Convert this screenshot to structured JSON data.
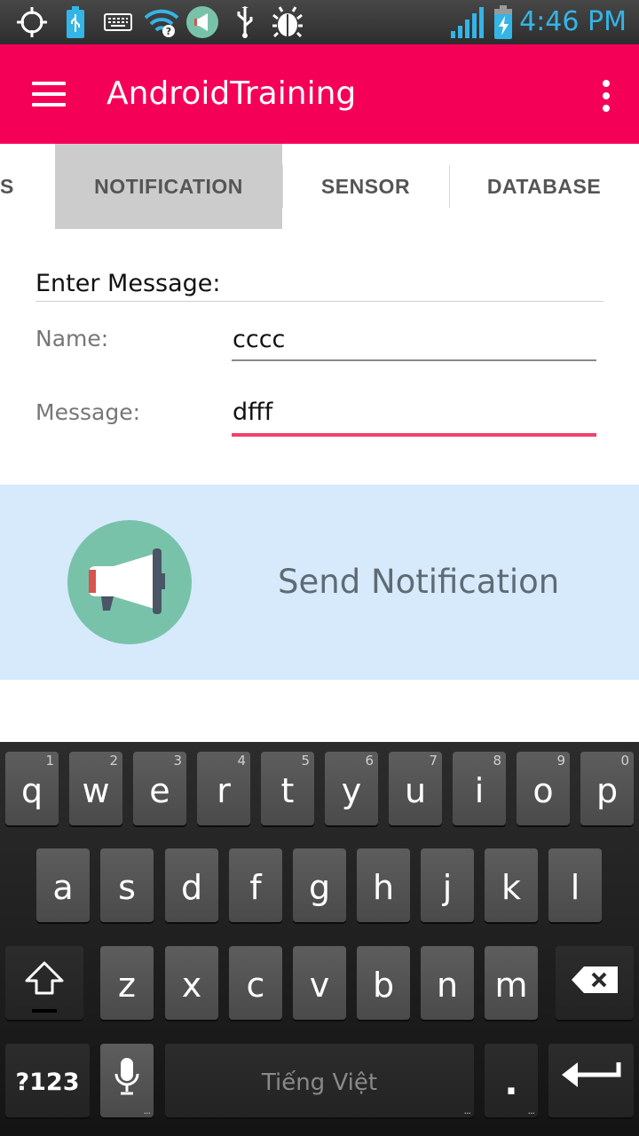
{
  "status_bar": {
    "time": "4:46 PM",
    "icons": [
      "location-icon",
      "usb-battery-icon",
      "keyboard-icon",
      "wifi-icon",
      "notification-app-icon",
      "usb-icon",
      "debug-bug-icon",
      "signal-icon",
      "battery-charging-icon"
    ]
  },
  "app_bar": {
    "title": "AndroidTraining",
    "nav_icon": "hamburger-menu-icon",
    "overflow_icon": "overflow-menu-icon",
    "color": "#f50057"
  },
  "tabs": [
    {
      "label": "S",
      "active": false
    },
    {
      "label": "NOTIFICATION",
      "active": true
    },
    {
      "label": "SENSOR",
      "active": false
    },
    {
      "label": "DATABASE",
      "active": false
    }
  ],
  "form": {
    "heading": "Enter Message:",
    "name_label": "Name:",
    "name_value": "cccc",
    "message_label": "Message:",
    "message_value": "dfff",
    "accent": "#f0426b"
  },
  "send_card": {
    "label": "Send Notification",
    "icon": "megaphone-icon",
    "background": "#d6eafb"
  },
  "keyboard": {
    "row1": [
      {
        "key": "q",
        "sub": "1"
      },
      {
        "key": "w",
        "sub": "2"
      },
      {
        "key": "e",
        "sub": "3"
      },
      {
        "key": "r",
        "sub": "4"
      },
      {
        "key": "t",
        "sub": "5"
      },
      {
        "key": "y",
        "sub": "6"
      },
      {
        "key": "u",
        "sub": "7"
      },
      {
        "key": "i",
        "sub": "8"
      },
      {
        "key": "o",
        "sub": "9"
      },
      {
        "key": "p",
        "sub": "0"
      }
    ],
    "row2": [
      "a",
      "s",
      "d",
      "f",
      "g",
      "h",
      "j",
      "k",
      "l"
    ],
    "row3": [
      "z",
      "x",
      "c",
      "v",
      "b",
      "n",
      "m"
    ],
    "symbols_label": "?123",
    "space_label": "Tiếng Việt",
    "period_label": ".",
    "dots_label": "...",
    "shift_icon": "shift-icon",
    "backspace_icon": "backspace-icon",
    "mic_icon": "microphone-icon",
    "enter_icon": "enter-icon"
  }
}
